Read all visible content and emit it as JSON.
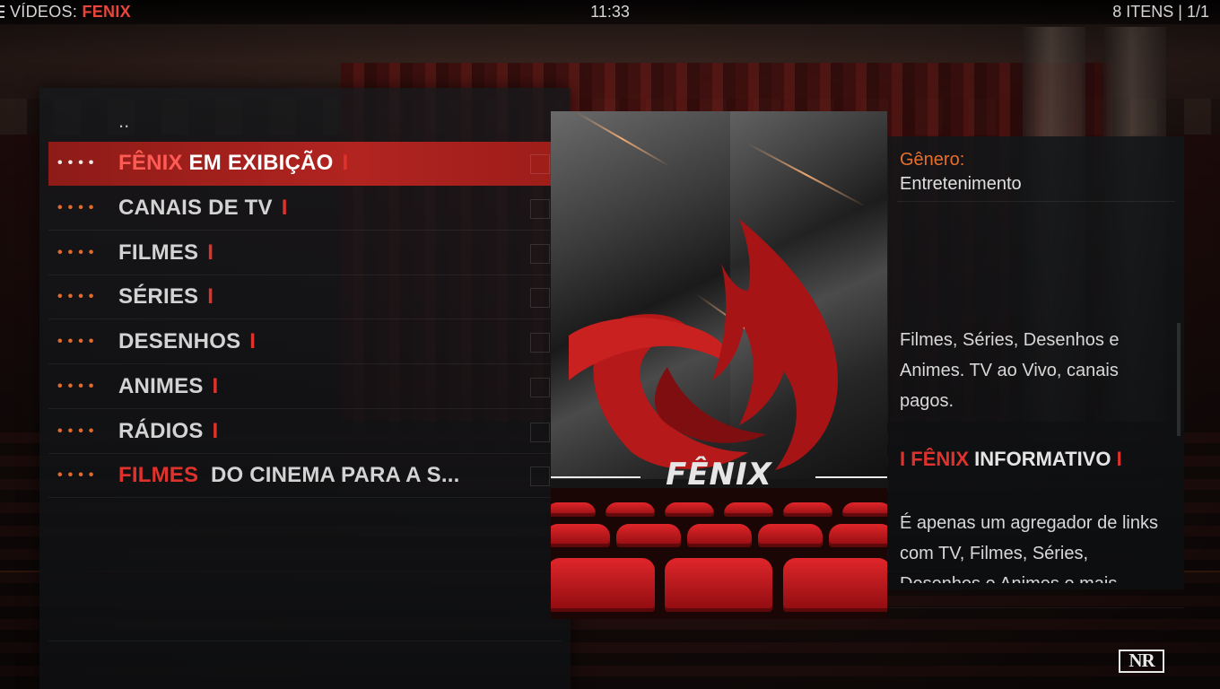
{
  "header": {
    "section": "VÍDEOS:",
    "addon": "FENIX",
    "clock": "11:33",
    "item_count": "8 ITENS | 1/1"
  },
  "list": {
    "parent_label": "..",
    "dots": "••••",
    "items": [
      {
        "accent": "FÊNIX",
        "text": " EM EXIBIÇÃO",
        "sep": "I",
        "focused": true
      },
      {
        "accent": "",
        "text": "CANAIS DE TV",
        "sep": "I",
        "focused": false
      },
      {
        "accent": "",
        "text": "FILMES",
        "sep": "I",
        "focused": false
      },
      {
        "accent": "",
        "text": "SÉRIES",
        "sep": "I",
        "focused": false
      },
      {
        "accent": "",
        "text": "DESENHOS",
        "sep": "I",
        "focused": false
      },
      {
        "accent": "",
        "text": "ANIMES",
        "sep": "I",
        "focused": false
      },
      {
        "accent": "",
        "text": "RÁDIOS",
        "sep": "I",
        "focused": false
      },
      {
        "accent": "FILMES",
        "text": "  DO CINEMA PARA A S...",
        "sep": "",
        "focused": false
      }
    ]
  },
  "poster": {
    "logo_text": "FÊNIX",
    "colors": {
      "brand_red": "#d3211f",
      "seat_red": "#e0262a"
    }
  },
  "info": {
    "genre_label": "Gênero:",
    "genre_value": "Entretenimento",
    "plot": "Filmes, Séries, Desenhos e Animes. TV  ao Vivo, canais pagos.",
    "heading_bar_left": "I",
    "heading_accent": "FÊNIX",
    "heading_text": "INFORMATIVO",
    "heading_bar_right": "I",
    "description": "É apenas um agregador de links com TV, Filmes, Séries, Desenhos e Animes e mais."
  },
  "badge": {
    "text": "NR"
  },
  "colors": {
    "accent_orange": "#e56f2c",
    "accent_red": "#e0322c",
    "focus_red": "#b22420"
  }
}
